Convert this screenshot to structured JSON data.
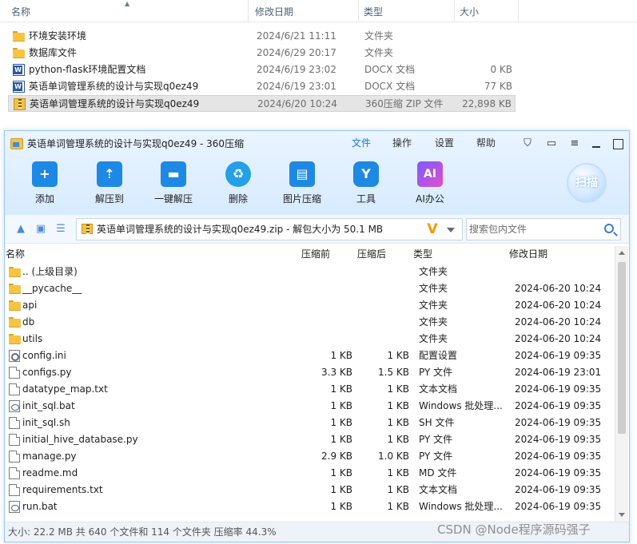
{
  "explorer": {
    "columns": {
      "name": "名称",
      "modified": "修改日期",
      "type": "类型",
      "size": "大小"
    },
    "rows": [
      {
        "name": "环境安装环境",
        "modified": "2024/6/21 11:11",
        "type": "文件夹",
        "size": "",
        "icon": "folder-icon"
      },
      {
        "name": "数据库文件",
        "modified": "2024/6/29 20:17",
        "type": "文件夹",
        "size": "",
        "icon": "folder-icon"
      },
      {
        "name": "python-flask环境配置文档",
        "modified": "2024/6/19 23:02",
        "type": "DOCX 文档",
        "size": "0 KB",
        "icon": "docx-icon"
      },
      {
        "name": "英语单词管理系统的设计与实现q0ez49",
        "modified": "2024/6/19 23:01",
        "type": "DOCX 文档",
        "size": "77 KB",
        "icon": "docx-icon"
      },
      {
        "name": "英语单词管理系统的设计与实现q0ez49",
        "modified": "2024/6/20 10:24",
        "type": "360压缩 ZIP 文件",
        "size": "22,898 KB",
        "icon": "zip-icon"
      }
    ]
  },
  "zip": {
    "title": "英语单词管理系统的设计与实现q0ez49 - 360压缩",
    "menu": {
      "file": "文件",
      "operate": "操作",
      "settings": "设置",
      "help": "帮助"
    },
    "toolbar": {
      "add": "添加",
      "extract_to": "解压到",
      "one_click_extract": "一键解压",
      "delete": "删除",
      "image_compress": "图片压缩",
      "tools": "工具",
      "ai_office": "AI办公",
      "scan": "扫描"
    },
    "address": "英语单词管理系统的设计与实现q0ez49.zip - 解包大小为 50.1 MB",
    "search_placeholder": "搜索包内文件",
    "columns": {
      "name": "名称",
      "before": "压缩前",
      "after": "压缩后",
      "type": "类型",
      "modified": "修改日期"
    },
    "rows": [
      {
        "name": ".. (上级目录)",
        "before": "",
        "after": "",
        "type": "文件夹",
        "modified": "",
        "icon": "folder-icon"
      },
      {
        "name": "__pycache__",
        "before": "",
        "after": "",
        "type": "文件夹",
        "modified": "2024-06-20 10:24",
        "icon": "folder-icon"
      },
      {
        "name": "api",
        "before": "",
        "after": "",
        "type": "文件夹",
        "modified": "2024-06-20 10:24",
        "icon": "folder-icon"
      },
      {
        "name": "db",
        "before": "",
        "after": "",
        "type": "文件夹",
        "modified": "2024-06-20 10:24",
        "icon": "folder-icon"
      },
      {
        "name": "utils",
        "before": "",
        "after": "",
        "type": "文件夹",
        "modified": "2024-06-20 10:24",
        "icon": "folder-icon"
      },
      {
        "name": "config.ini",
        "before": "1 KB",
        "after": "1 KB",
        "type": "配置设置",
        "modified": "2024-06-19 09:35",
        "icon": "settings-file-icon"
      },
      {
        "name": "configs.py",
        "before": "3.3 KB",
        "after": "1.5 KB",
        "type": "PY 文件",
        "modified": "2024-06-19 23:01",
        "icon": "file-icon"
      },
      {
        "name": "datatype_map.txt",
        "before": "1 KB",
        "after": "1 KB",
        "type": "文本文档",
        "modified": "2024-06-19 09:35",
        "icon": "file-icon"
      },
      {
        "name": "init_sql.bat",
        "before": "1 KB",
        "after": "1 KB",
        "type": "Windows 批处理...",
        "modified": "2024-06-19 09:35",
        "icon": "batch-file-icon"
      },
      {
        "name": "init_sql.sh",
        "before": "1 KB",
        "after": "1 KB",
        "type": "SH 文件",
        "modified": "2024-06-19 09:35",
        "icon": "file-icon"
      },
      {
        "name": "initial_hive_database.py",
        "before": "1 KB",
        "after": "1 KB",
        "type": "PY 文件",
        "modified": "2024-06-19 09:35",
        "icon": "file-icon"
      },
      {
        "name": "manage.py",
        "before": "2.9 KB",
        "after": "1.0 KB",
        "type": "PY 文件",
        "modified": "2024-06-19 09:35",
        "icon": "file-icon"
      },
      {
        "name": "readme.md",
        "before": "1 KB",
        "after": "1 KB",
        "type": "MD 文件",
        "modified": "2024-06-19 09:35",
        "icon": "file-icon"
      },
      {
        "name": "requirements.txt",
        "before": "1 KB",
        "after": "1 KB",
        "type": "文本文档",
        "modified": "2024-06-19 09:35",
        "icon": "file-icon"
      },
      {
        "name": "run.bat",
        "before": "1 KB",
        "after": "1 KB",
        "type": "Windows 批处理...",
        "modified": "2024-06-19 09:35",
        "icon": "batch-file-icon"
      }
    ],
    "status": "大小: 22.2 MB 共 640 个文件和 114 个文件夹 压缩率 44.3%"
  },
  "watermark": "CSDN @Node程序源码强子"
}
